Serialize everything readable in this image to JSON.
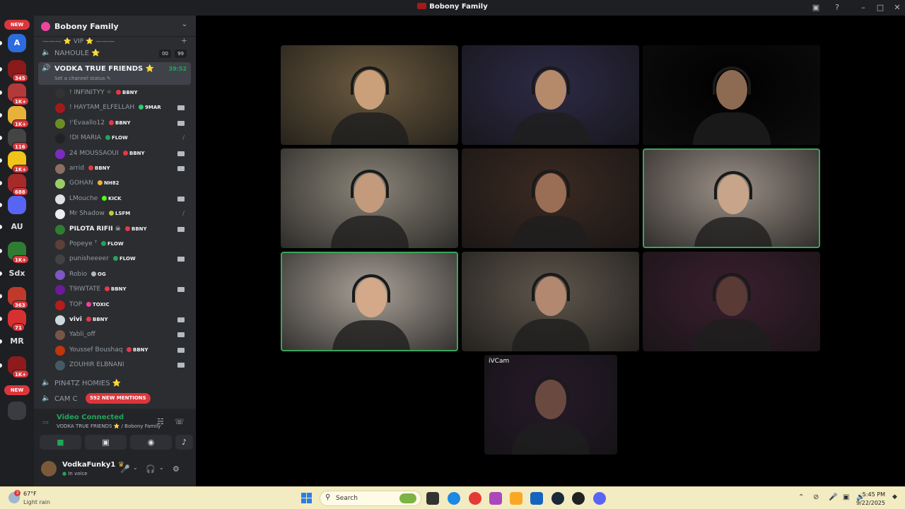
{
  "window": {
    "title": "Bobony Family",
    "icons": {
      "logo": "bobony-logo",
      "screen": "screen-share-icon",
      "help": "help-icon",
      "minimize": "minimize-icon",
      "maximize": "maximize-icon",
      "close": "close-icon"
    }
  },
  "rail": {
    "new_label": "NEW",
    "servers": [
      {
        "label": "A",
        "color": "#2d6cdf"
      },
      {
        "label": "",
        "color": "#8b1a1a",
        "badge": "345"
      },
      {
        "label": "",
        "color": "#b33a3a",
        "badge": "1K+"
      },
      {
        "label": "",
        "color": "#e8b23a",
        "badge": "1K+"
      },
      {
        "label": "",
        "color": "#444",
        "badge": "116"
      },
      {
        "label": "",
        "color": "#f0c419",
        "badge": "1K+"
      },
      {
        "label": "",
        "color": "#a52a2a",
        "badge": "688"
      },
      {
        "label": "",
        "color": "#5865f2"
      },
      {
        "label": "AU",
        "color": "transparent"
      },
      {
        "label": "",
        "color": "#2f7d32",
        "badge": "1K+"
      },
      {
        "label": "Sdx",
        "color": "transparent"
      },
      {
        "label": "",
        "color": "#c0392b",
        "badge": "363"
      },
      {
        "label": "",
        "color": "#d63031",
        "badge": "71"
      },
      {
        "label": "MR",
        "color": "transparent"
      },
      {
        "label": "",
        "color": "#8e1b1b",
        "badge": "1K+"
      }
    ]
  },
  "sidebar": {
    "guild_name": "Bobony Family",
    "category": "——— ⭐ VIP ⭐ ———",
    "channels": {
      "nahoule": {
        "name": "NAHOULE",
        "counts": [
          "00",
          "99"
        ]
      },
      "active": {
        "name": "VODKA TRUE FRIENDS",
        "timer": "39:52",
        "status": "Set a channel status"
      },
      "pin4tz": {
        "name": "PIN4TZ HOMIES"
      },
      "cam": {
        "name": "CAM C"
      }
    },
    "members": [
      {
        "name": "! INFINITYY ✧",
        "tag": "BBNY",
        "tag_color": "#e63946",
        "cam": "none",
        "avatar": "#333"
      },
      {
        "name": "! HAYTAM_ELFELLAH",
        "tag": "9MAR",
        "tag_color": "#2ecc71",
        "cam": "on",
        "avatar": "#a31a1a"
      },
      {
        "name": "!'Evaallo12",
        "tag": "BBNY",
        "tag_color": "#e63946",
        "cam": "on",
        "avatar": "#6b8e23"
      },
      {
        "name": "!DI MARIA",
        "tag": "FLOW",
        "tag_color": "#23a55a",
        "cam": "off",
        "avatar": "#222"
      },
      {
        "name": "24 MOUSSAOUI",
        "tag": "BBNY",
        "tag_color": "#e63946",
        "cam": "on",
        "avatar": "#7b2cbf"
      },
      {
        "name": "arrid",
        "tag": "BBNY",
        "tag_color": "#e63946",
        "cam": "on",
        "avatar": "#8d6e63"
      },
      {
        "name": "GOHAN",
        "tag": "NH82",
        "tag_color": "#f0b232",
        "cam": "none",
        "avatar": "#9ccc65"
      },
      {
        "name": "LMouche",
        "tag": "KICK",
        "tag_color": "#53fc18",
        "cam": "on",
        "avatar": "#e0e0e0"
      },
      {
        "name": "Mr Shadow",
        "tag": "LSFM",
        "tag_color": "#c0ca33",
        "cam": "off",
        "avatar": "#eeeeee"
      },
      {
        "name": "PILOTA RIFII ☠",
        "tag": "BBNY",
        "tag_color": "#e63946",
        "cam": "on",
        "avatar": "#2e7d32",
        "bright": true
      },
      {
        "name": "Popeye ᵀ",
        "tag": "FLOW",
        "tag_color": "#23a55a",
        "cam": "none",
        "avatar": "#5d4037"
      },
      {
        "name": "punisheeeer",
        "tag": "FLOW",
        "tag_color": "#23a55a",
        "cam": "on",
        "avatar": "#424242"
      },
      {
        "name": "Robio",
        "tag": "OG",
        "tag_color": "#b5bac1",
        "cam": "none",
        "avatar": "#7e57c2"
      },
      {
        "name": "T9IWTATE",
        "tag": "BBNY",
        "tag_color": "#e63946",
        "cam": "on",
        "avatar": "#6a1b9a"
      },
      {
        "name": "TOP",
        "tag": "TOXIC",
        "tag_color": "#eb459e",
        "cam": "none",
        "avatar": "#b71c1c"
      },
      {
        "name": "vivi",
        "tag": "BBNY",
        "tag_color": "#e63946",
        "cam": "on",
        "avatar": "#cfd8dc",
        "bright": true
      },
      {
        "name": "Yabli_off",
        "tag": "",
        "tag_color": "",
        "cam": "on",
        "avatar": "#795548"
      },
      {
        "name": "Youssef Boushaq",
        "tag": "BBNY",
        "tag_color": "#e63946",
        "cam": "on",
        "avatar": "#bf360c"
      },
      {
        "name": "ZOUHIR ELBNANI",
        "tag": "",
        "tag_color": "",
        "cam": "on",
        "avatar": "#455a64"
      }
    ],
    "mentions_pill": "592 NEW MENTIONS"
  },
  "voice": {
    "title": "Video Connected",
    "subtitle": "VODKA TRUE FRIENDS ⭐ / Bobony Family",
    "buttons": [
      "camera-icon",
      "screen-share-icon",
      "activity-icon",
      "soundboard-icon"
    ]
  },
  "user": {
    "name": "VodkaFunky1",
    "status": "In voice"
  },
  "stage": {
    "cam_label": "iVCam",
    "tiles": [
      {
        "name": "video-tile-1",
        "bg": "#6b5a3f",
        "skin": "#c9a07a",
        "speaking": false
      },
      {
        "name": "video-tile-2",
        "bg": "#2d2a45",
        "skin": "#b58a6b",
        "speaking": false
      },
      {
        "name": "video-tile-3",
        "bg": "#000000",
        "skin": "#8d6a52",
        "speaking": false
      },
      {
        "name": "video-tile-4",
        "bg": "#8a8478",
        "skin": "#c49a7c",
        "speaking": false
      },
      {
        "name": "video-tile-5",
        "bg": "#3b2a22",
        "skin": "#9a6e55",
        "speaking": false
      },
      {
        "name": "video-tile-6",
        "bg": "#9a8f86",
        "skin": "#c8a58a",
        "speaking": true
      },
      {
        "name": "video-tile-7",
        "bg": "#a8a096",
        "skin": "#d3a98a",
        "speaking": true
      },
      {
        "name": "video-tile-8",
        "bg": "#5f564c",
        "skin": "#b28870",
        "speaking": false
      },
      {
        "name": "video-tile-9",
        "bg": "#3a1f2e",
        "skin": "#5a3a35",
        "speaking": false
      },
      {
        "name": "video-tile-ivcam",
        "bg": "#261a2a",
        "skin": "#6a4a40",
        "speaking": false
      }
    ]
  },
  "taskbar": {
    "weather_temp": "67°F",
    "weather_cond": "Light rain",
    "weather_badge": "3",
    "search_placeholder": "Search",
    "time": "5:45 PM",
    "date": "9/22/2025"
  }
}
